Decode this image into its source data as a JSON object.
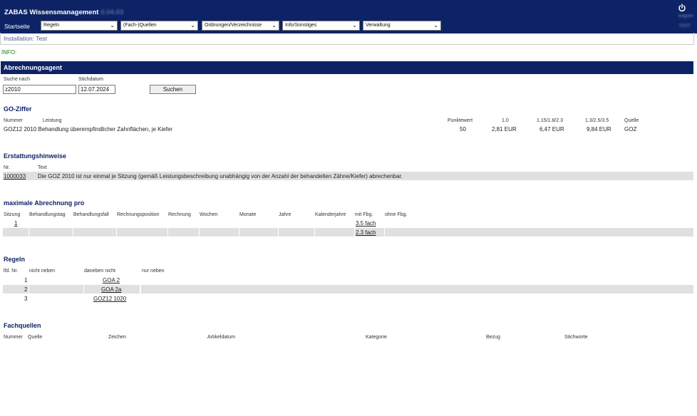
{
  "app": {
    "title": "ZABAS Wissensmanagement",
    "version": "0.04.03",
    "user_name": "wagner",
    "user_sub": "TEST"
  },
  "nav": {
    "label": "Startseite",
    "selects": [
      {
        "value": "Regeln"
      },
      {
        "value": "(Fach-)Quellen"
      },
      {
        "value": "Ordnungen/Verzeichnisse"
      },
      {
        "value": "Info/Sonstiges"
      },
      {
        "value": "Verwaltung"
      }
    ]
  },
  "installation": "Installation: Test",
  "info": "INFO:",
  "agent": {
    "title": "Abrechnungsagent",
    "search_label": "Suche nach",
    "search_value": "z2010",
    "date_label": "Stichdatum",
    "date_value": "12.07.2024",
    "search_button": "Suchen"
  },
  "go": {
    "title": "GO-Ziffer",
    "headers": {
      "nummer": "Nummer",
      "leistung": "Leistung",
      "punktwert": "Punktewert",
      "f1": "1.0",
      "f2": "1.15/1.8/2.3",
      "f3": "1.3/2.5/3.5",
      "quelle": "Quelle"
    },
    "row": {
      "nummer": "GOZ12 2010",
      "leistung": "Behandlung überempfindlicher Zahnflächen, je Kiefer",
      "punktwert": "50",
      "f1": "2,81 EUR",
      "f2": "6,47 EUR",
      "f3": "9,84 EUR",
      "quelle": "GOZ"
    }
  },
  "hints": {
    "title": "Erstattungshinweise",
    "headers": {
      "nr": "Nr.",
      "text": "Text"
    },
    "row": {
      "nr": "1000033",
      "text": "Die GOZ 2010 ist nur einmal je Sitzung (gemäß Leistungsbeschreibung unabhängig von der Anzahl der behandelten Zähne/Kiefer) abrechenbar."
    }
  },
  "maxab": {
    "title": "maximale Abrechnung pro",
    "headers": [
      "Sitzung",
      "Behandlungstag",
      "Behandlungsfall",
      "Rechnungsposition",
      "Rechnung",
      "Wochen",
      "Monate",
      "Jahre",
      "Kalenderjahre",
      "mit Fbg.",
      "ohne Fbg."
    ],
    "row1": {
      "sitzung": "1",
      "mit": "3.5 fach"
    },
    "row2": {
      "mit": "2.3 fach"
    }
  },
  "rules": {
    "title": "Regeln",
    "headers": [
      "lfd. Nr.",
      "nicht neben",
      "daneben nicht",
      "nur neben"
    ],
    "rows": [
      {
        "nr": "1",
        "daneben": "GOA 2"
      },
      {
        "nr": "2",
        "daneben": "GOA 2a"
      },
      {
        "nr": "3",
        "daneben": "GOZ12 1020"
      }
    ]
  },
  "sources": {
    "title": "Fachquellen",
    "headers": [
      "Nummer",
      "Quelle",
      "Zeichen",
      "Artikeldatum",
      "Kategorie",
      "Bezug",
      "Stichworte"
    ]
  },
  "colors": {
    "brand": "#0d2366",
    "stripe": "#e0e0e0",
    "link": "#1a4ea0",
    "info": "#1c7a1c"
  },
  "icons": {
    "power": "power-icon",
    "dropdown": "chevron-down-icon"
  }
}
